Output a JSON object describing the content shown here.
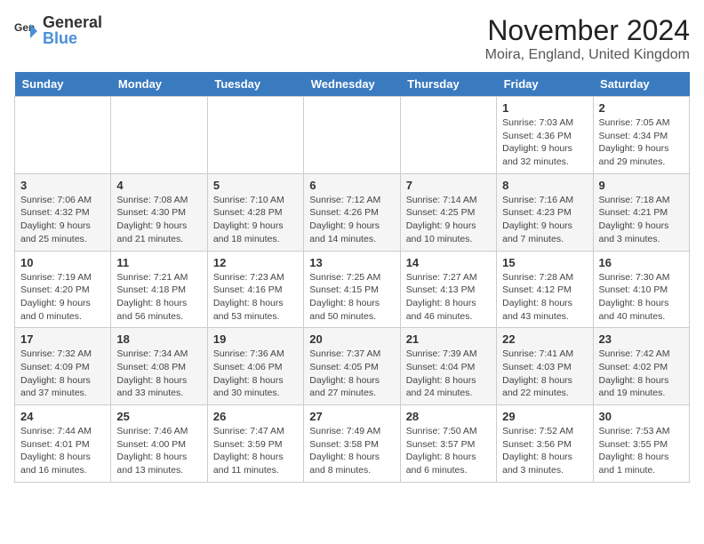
{
  "header": {
    "logo_general": "General",
    "logo_blue": "Blue",
    "month_title": "November 2024",
    "location": "Moira, England, United Kingdom"
  },
  "columns": [
    "Sunday",
    "Monday",
    "Tuesday",
    "Wednesday",
    "Thursday",
    "Friday",
    "Saturday"
  ],
  "weeks": [
    [
      {
        "day": "",
        "info": ""
      },
      {
        "day": "",
        "info": ""
      },
      {
        "day": "",
        "info": ""
      },
      {
        "day": "",
        "info": ""
      },
      {
        "day": "",
        "info": ""
      },
      {
        "day": "1",
        "info": "Sunrise: 7:03 AM\nSunset: 4:36 PM\nDaylight: 9 hours and 32 minutes."
      },
      {
        "day": "2",
        "info": "Sunrise: 7:05 AM\nSunset: 4:34 PM\nDaylight: 9 hours and 29 minutes."
      }
    ],
    [
      {
        "day": "3",
        "info": "Sunrise: 7:06 AM\nSunset: 4:32 PM\nDaylight: 9 hours and 25 minutes."
      },
      {
        "day": "4",
        "info": "Sunrise: 7:08 AM\nSunset: 4:30 PM\nDaylight: 9 hours and 21 minutes."
      },
      {
        "day": "5",
        "info": "Sunrise: 7:10 AM\nSunset: 4:28 PM\nDaylight: 9 hours and 18 minutes."
      },
      {
        "day": "6",
        "info": "Sunrise: 7:12 AM\nSunset: 4:26 PM\nDaylight: 9 hours and 14 minutes."
      },
      {
        "day": "7",
        "info": "Sunrise: 7:14 AM\nSunset: 4:25 PM\nDaylight: 9 hours and 10 minutes."
      },
      {
        "day": "8",
        "info": "Sunrise: 7:16 AM\nSunset: 4:23 PM\nDaylight: 9 hours and 7 minutes."
      },
      {
        "day": "9",
        "info": "Sunrise: 7:18 AM\nSunset: 4:21 PM\nDaylight: 9 hours and 3 minutes."
      }
    ],
    [
      {
        "day": "10",
        "info": "Sunrise: 7:19 AM\nSunset: 4:20 PM\nDaylight: 9 hours and 0 minutes."
      },
      {
        "day": "11",
        "info": "Sunrise: 7:21 AM\nSunset: 4:18 PM\nDaylight: 8 hours and 56 minutes."
      },
      {
        "day": "12",
        "info": "Sunrise: 7:23 AM\nSunset: 4:16 PM\nDaylight: 8 hours and 53 minutes."
      },
      {
        "day": "13",
        "info": "Sunrise: 7:25 AM\nSunset: 4:15 PM\nDaylight: 8 hours and 50 minutes."
      },
      {
        "day": "14",
        "info": "Sunrise: 7:27 AM\nSunset: 4:13 PM\nDaylight: 8 hours and 46 minutes."
      },
      {
        "day": "15",
        "info": "Sunrise: 7:28 AM\nSunset: 4:12 PM\nDaylight: 8 hours and 43 minutes."
      },
      {
        "day": "16",
        "info": "Sunrise: 7:30 AM\nSunset: 4:10 PM\nDaylight: 8 hours and 40 minutes."
      }
    ],
    [
      {
        "day": "17",
        "info": "Sunrise: 7:32 AM\nSunset: 4:09 PM\nDaylight: 8 hours and 37 minutes."
      },
      {
        "day": "18",
        "info": "Sunrise: 7:34 AM\nSunset: 4:08 PM\nDaylight: 8 hours and 33 minutes."
      },
      {
        "day": "19",
        "info": "Sunrise: 7:36 AM\nSunset: 4:06 PM\nDaylight: 8 hours and 30 minutes."
      },
      {
        "day": "20",
        "info": "Sunrise: 7:37 AM\nSunset: 4:05 PM\nDaylight: 8 hours and 27 minutes."
      },
      {
        "day": "21",
        "info": "Sunrise: 7:39 AM\nSunset: 4:04 PM\nDaylight: 8 hours and 24 minutes."
      },
      {
        "day": "22",
        "info": "Sunrise: 7:41 AM\nSunset: 4:03 PM\nDaylight: 8 hours and 22 minutes."
      },
      {
        "day": "23",
        "info": "Sunrise: 7:42 AM\nSunset: 4:02 PM\nDaylight: 8 hours and 19 minutes."
      }
    ],
    [
      {
        "day": "24",
        "info": "Sunrise: 7:44 AM\nSunset: 4:01 PM\nDaylight: 8 hours and 16 minutes."
      },
      {
        "day": "25",
        "info": "Sunrise: 7:46 AM\nSunset: 4:00 PM\nDaylight: 8 hours and 13 minutes."
      },
      {
        "day": "26",
        "info": "Sunrise: 7:47 AM\nSunset: 3:59 PM\nDaylight: 8 hours and 11 minutes."
      },
      {
        "day": "27",
        "info": "Sunrise: 7:49 AM\nSunset: 3:58 PM\nDaylight: 8 hours and 8 minutes."
      },
      {
        "day": "28",
        "info": "Sunrise: 7:50 AM\nSunset: 3:57 PM\nDaylight: 8 hours and 6 minutes."
      },
      {
        "day": "29",
        "info": "Sunrise: 7:52 AM\nSunset: 3:56 PM\nDaylight: 8 hours and 3 minutes."
      },
      {
        "day": "30",
        "info": "Sunrise: 7:53 AM\nSunset: 3:55 PM\nDaylight: 8 hours and 1 minute."
      }
    ]
  ]
}
